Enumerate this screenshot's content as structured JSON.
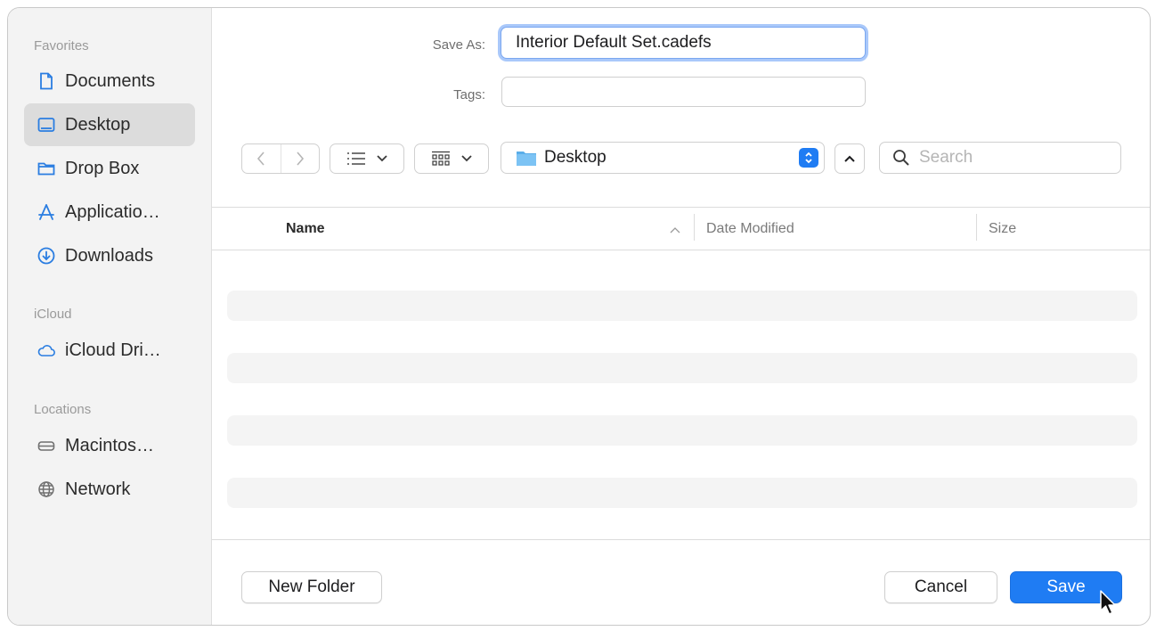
{
  "sidebar": {
    "sections": [
      {
        "title": "Favorites"
      },
      {
        "title": "iCloud"
      },
      {
        "title": "Locations"
      }
    ],
    "items": [
      {
        "label": "Documents",
        "icon": "document-icon"
      },
      {
        "label": "Desktop",
        "icon": "desktop-icon",
        "selected": true
      },
      {
        "label": "Drop Box",
        "icon": "folder-icon"
      },
      {
        "label": "Applicatio…",
        "icon": "applications-icon"
      },
      {
        "label": "Downloads",
        "icon": "downloads-icon"
      },
      {
        "label": "iCloud Dri…",
        "icon": "cloud-icon"
      },
      {
        "label": "Macintos…",
        "icon": "disk-icon"
      },
      {
        "label": "Network",
        "icon": "globe-icon"
      }
    ]
  },
  "form": {
    "save_as_label": "Save As:",
    "save_as_value": "Interior Default Set.cadefs",
    "tags_label": "Tags:",
    "tags_value": ""
  },
  "toolbar": {
    "location": "Desktop",
    "search_placeholder": "Search"
  },
  "table": {
    "columns": [
      "Name",
      "Date Modified",
      "Size"
    ],
    "rows": []
  },
  "buttons": {
    "new_folder": "New Folder",
    "cancel": "Cancel",
    "save": "Save"
  },
  "colors": {
    "accent": "#1f7cf3",
    "focus_ring": "#a9c8fa",
    "folder": "#5aaee9"
  }
}
